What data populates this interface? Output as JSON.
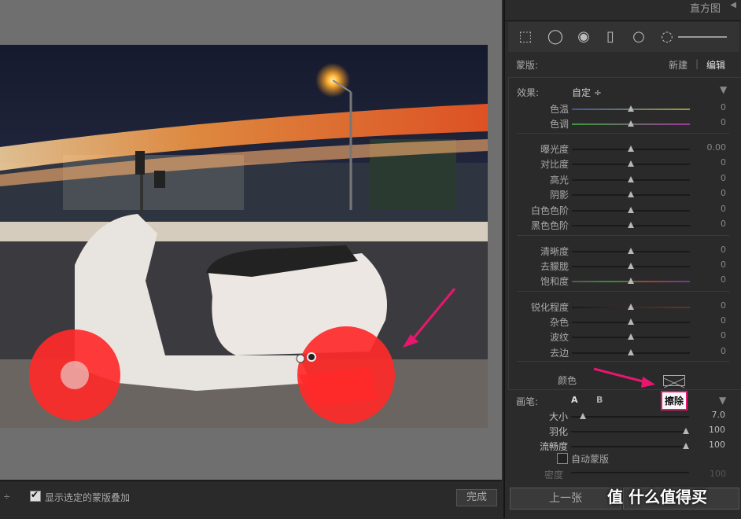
{
  "panel": {
    "header_title": "直方图",
    "mask_label": "蒙版:",
    "mask_new": "新建",
    "mask_edit": "编辑",
    "effect_label": "效果:",
    "effect_value": "自定 ÷",
    "sliders": [
      {
        "name": "色温",
        "value": "0"
      },
      {
        "name": "色调",
        "value": "0"
      },
      {
        "name": "曝光度",
        "value": "0.00"
      },
      {
        "name": "对比度",
        "value": "0"
      },
      {
        "name": "高光",
        "value": "0"
      },
      {
        "name": "阴影",
        "value": "0"
      },
      {
        "name": "白色色阶",
        "value": "0"
      },
      {
        "name": "黑色色阶",
        "value": "0"
      },
      {
        "name": "清晰度",
        "value": "0"
      },
      {
        "name": "去朦胧",
        "value": "0"
      },
      {
        "name": "饱和度",
        "value": "0"
      },
      {
        "name": "锐化程度",
        "value": "0"
      },
      {
        "name": "杂色",
        "value": "0"
      },
      {
        "name": "波纹",
        "value": "0"
      },
      {
        "name": "去边",
        "value": "0"
      }
    ],
    "color_label": "颜色",
    "brush_label": "画笔:",
    "brush_a": "A",
    "brush_b": "B",
    "brush_erase": "擦除",
    "brush_sliders": [
      {
        "name": "大小",
        "value": "7.0",
        "level": 0.1
      },
      {
        "name": "羽化",
        "value": "100",
        "level": 1.0
      },
      {
        "name": "流畅度",
        "value": "100",
        "level": 1.0
      }
    ],
    "auto_mask": "自动蒙版",
    "density": "密度",
    "density_value": "100",
    "prev_button": "上一张",
    "watermark": "值 什么值得买"
  },
  "bottom": {
    "overlay_label": "显示选定的蒙版叠加",
    "done_button": "完成"
  },
  "colors": {
    "accent": "#e8166f",
    "mask_overlay": "#ff2a2a"
  }
}
